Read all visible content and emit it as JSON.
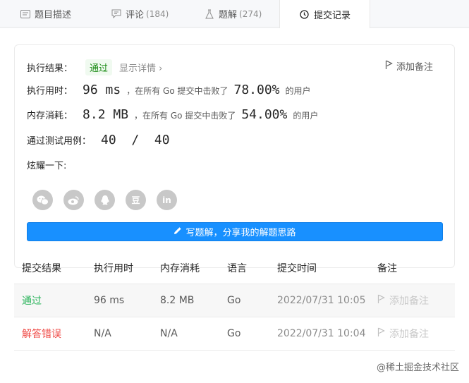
{
  "tabs": [
    {
      "label": "题目描述",
      "count": "",
      "icon": "description-icon"
    },
    {
      "label": "评论",
      "count": "(184)",
      "icon": "comment-icon"
    },
    {
      "label": "题解",
      "count": "(274)",
      "icon": "flask-icon"
    },
    {
      "label": "提交记录",
      "count": "",
      "icon": "clock-icon"
    }
  ],
  "result": {
    "exec_result_label": "执行结果：",
    "status": "通过",
    "details_link": "显示详情 ›",
    "add_note": "添加备注",
    "runtime_label": "执行用时：",
    "runtime_value": "96 ms",
    "runtime_prefix": "，在所有 Go 提交中击败了",
    "runtime_percent": "78.00%",
    "runtime_suffix": "的用户",
    "memory_label": "内存消耗：",
    "memory_value": "8.2 MB",
    "memory_prefix": "，在所有 Go 提交中击败了",
    "memory_percent": "54.00%",
    "memory_suffix": "的用户",
    "tests_label": "通过测试用例：",
    "tests_value": "40  /  40",
    "share_label": "炫耀一下:",
    "share_icons": [
      "wechat-icon",
      "weibo-icon",
      "qq-icon",
      "douban-icon",
      "linkedin-icon"
    ],
    "douban_glyph": "豆",
    "linkedin_glyph": "in",
    "write_button": "写题解，分享我的解题思路"
  },
  "table": {
    "headers": [
      "提交结果",
      "执行用时",
      "内存消耗",
      "语言",
      "提交时间",
      "备注"
    ],
    "rows": [
      {
        "status": "通过",
        "runtime": "96 ms",
        "memory": "8.2 MB",
        "lang": "Go",
        "time": "2022/07/31 10:05",
        "note": "添加备注"
      },
      {
        "status": "解答错误",
        "runtime": "N/A",
        "memory": "N/A",
        "lang": "Go",
        "time": "2022/07/31 10:04",
        "note": "添加备注"
      }
    ]
  },
  "watermark": "@稀土掘金技术社区",
  "colors": {
    "accent": "#1890ff",
    "pass": "#2db55d",
    "fail": "#ef4743"
  }
}
